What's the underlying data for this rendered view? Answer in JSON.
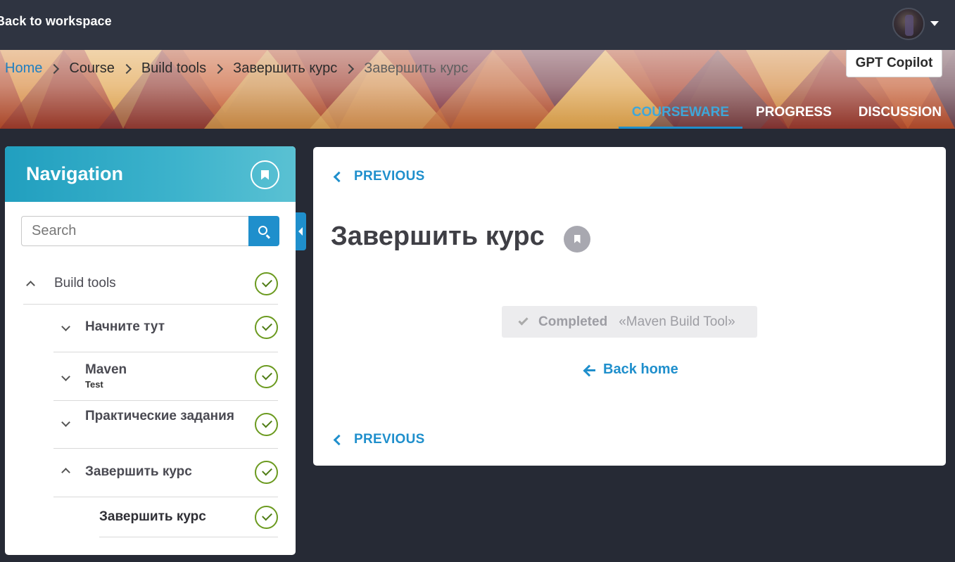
{
  "topbar": {
    "back_label": "Back to workspace"
  },
  "breadcrumb": [
    {
      "label": "Home"
    },
    {
      "label": "Course"
    },
    {
      "label": "Build tools"
    },
    {
      "label": "Завершить курс"
    },
    {
      "label": "Завершить курс"
    }
  ],
  "header": {
    "gpt_button": "GPT Copilot",
    "tabs": [
      {
        "label": "COURSEWARE",
        "active": true
      },
      {
        "label": "PROGRESS",
        "active": false
      },
      {
        "label": "DISCUSSION",
        "active": false
      }
    ]
  },
  "navigation": {
    "title": "Navigation",
    "search_placeholder": "Search",
    "items": [
      {
        "label": "Build tools",
        "expanded": true,
        "completed": true
      },
      {
        "label": "Начните тут",
        "expanded": false,
        "completed": true
      },
      {
        "label": "Maven",
        "sublabel": "Test",
        "expanded": false,
        "completed": true
      },
      {
        "label": "Практические задания",
        "expanded": false,
        "completed": true
      },
      {
        "label": "Завершить курс",
        "expanded": true,
        "completed": true
      },
      {
        "label": "Завершить курс",
        "completed": true
      }
    ]
  },
  "content": {
    "previous_top": "PREVIOUS",
    "title": "Завершить курс",
    "completed_label": "Completed",
    "completed_name": "«Maven Build Tool»",
    "back_home": "Back home",
    "previous_bottom": "PREVIOUS"
  },
  "colors": {
    "accent": "#1f8fcc",
    "topbar": "#2f3441",
    "background": "#262a35",
    "check": "#6b9a1f"
  }
}
